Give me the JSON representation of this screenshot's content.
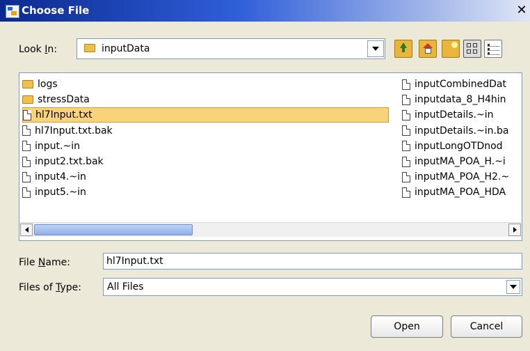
{
  "window": {
    "title": "Choose File"
  },
  "look_in": {
    "label_prefix": "Look ",
    "label_mnemonic": "I",
    "label_suffix": "n:",
    "value": "inputData"
  },
  "toolbar": {
    "icons": [
      "up-one-level-icon",
      "home-folder-icon",
      "new-folder-icon",
      "list-view-icon",
      "details-view-icon"
    ]
  },
  "files": {
    "left_column": [
      {
        "name": "logs",
        "type": "folder",
        "selected": false
      },
      {
        "name": "stressData",
        "type": "folder",
        "selected": false
      },
      {
        "name": "hl7Input.txt",
        "type": "file",
        "selected": true
      },
      {
        "name": "hl7Input.txt.bak",
        "type": "file",
        "selected": false
      },
      {
        "name": "input.~in",
        "type": "file",
        "selected": false
      },
      {
        "name": "input2.txt.bak",
        "type": "file",
        "selected": false
      },
      {
        "name": "input4.~in",
        "type": "file",
        "selected": false
      },
      {
        "name": "input5.~in",
        "type": "file",
        "selected": false
      }
    ],
    "right_column": [
      {
        "name": "inputCombinedDat",
        "type": "file"
      },
      {
        "name": "inputdata_8_H4hin",
        "type": "file"
      },
      {
        "name": "inputDetails.~in",
        "type": "file"
      },
      {
        "name": "inputDetails.~in.ba",
        "type": "file"
      },
      {
        "name": "inputLongOTDnod",
        "type": "file"
      },
      {
        "name": "inputMA_POA_H.~i",
        "type": "file"
      },
      {
        "name": "inputMA_POA_H2.~",
        "type": "file"
      },
      {
        "name": "inputMA_POA_HDA",
        "type": "file"
      }
    ]
  },
  "file_name": {
    "label_prefix": "File ",
    "label_mnemonic": "N",
    "label_suffix": "ame:",
    "value": "hl7Input.txt"
  },
  "file_type": {
    "label_prefix": "Files of ",
    "label_mnemonic": "T",
    "label_suffix": "ype:",
    "value": "All Files"
  },
  "buttons": {
    "open": "Open",
    "cancel": "Cancel"
  },
  "colors": {
    "selection": "#f9d37a",
    "title_bar": "#0b2a8f",
    "dialog_bg": "#ece9d8"
  }
}
